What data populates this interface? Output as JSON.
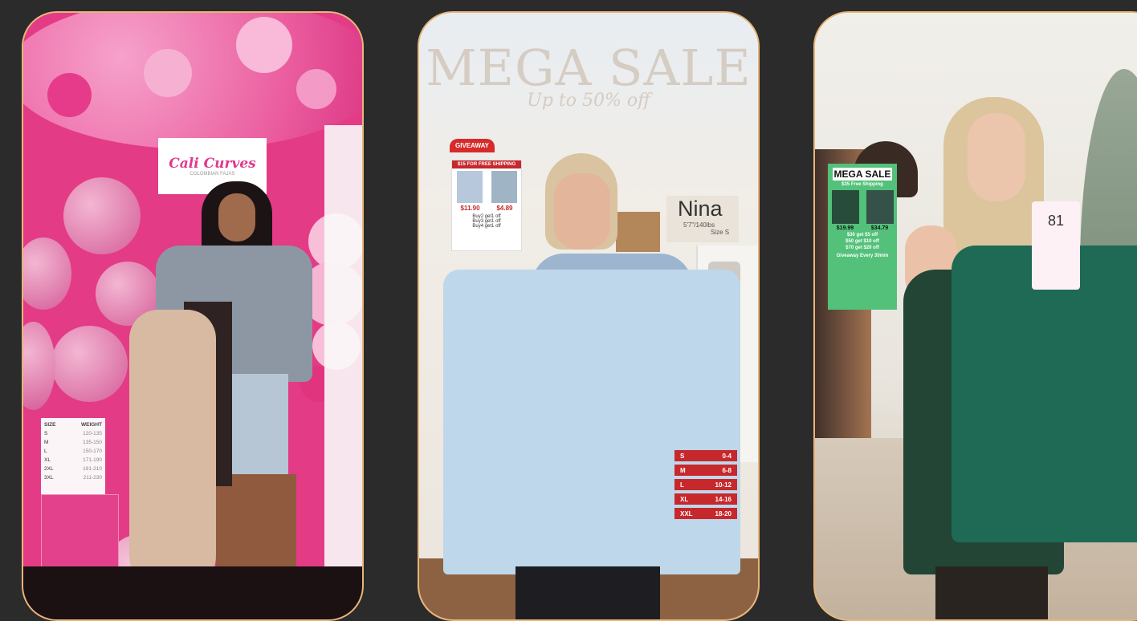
{
  "cards": [
    {
      "logo_text": "Cali Curves",
      "logo_subtitle": "COLOMBIAN FAJAS",
      "size_chart": {
        "header_size": "SIZE",
        "header_weight": "WEIGHT",
        "rows": [
          {
            "size": "S",
            "range": "120-135"
          },
          {
            "size": "M",
            "range": "135-150"
          },
          {
            "size": "L",
            "range": "150-170"
          },
          {
            "size": "XL",
            "range": "171-190"
          },
          {
            "size": "2XL",
            "range": "191-210"
          },
          {
            "size": "3XL",
            "range": "211-230"
          }
        ]
      }
    },
    {
      "headline": "MEGA SALE",
      "subheadline": "Up to 50% off",
      "giveaway": "GIVEAWAY",
      "promo_shipping": "$15 FOR FREE SHIPPING",
      "promo_prices": [
        "$11.90",
        "$4.89"
      ],
      "promo_offers": [
        "Buy2 get1 off",
        "Buy3 get1 off",
        "Buy4 get1 off"
      ],
      "model_name": "Nina",
      "model_height": "5'7\"/140lbs",
      "model_size": "Size S",
      "size_rows": [
        {
          "size": "S",
          "range": "0-4"
        },
        {
          "size": "M",
          "range": "6-8"
        },
        {
          "size": "L",
          "range": "10-12"
        },
        {
          "size": "XL",
          "range": "14-16"
        },
        {
          "size": "XXL",
          "range": "18-20"
        }
      ]
    },
    {
      "headline": "MEGA SALE",
      "free_shipping": "$35 Free Shipping",
      "prices": [
        "$19.99",
        "$34.79"
      ],
      "offers": [
        "$30 get $5 off",
        "$50 get $10 off",
        "$70 get $20 off"
      ],
      "footer": "Giveaway Every 30min",
      "tag_number": "81"
    }
  ]
}
